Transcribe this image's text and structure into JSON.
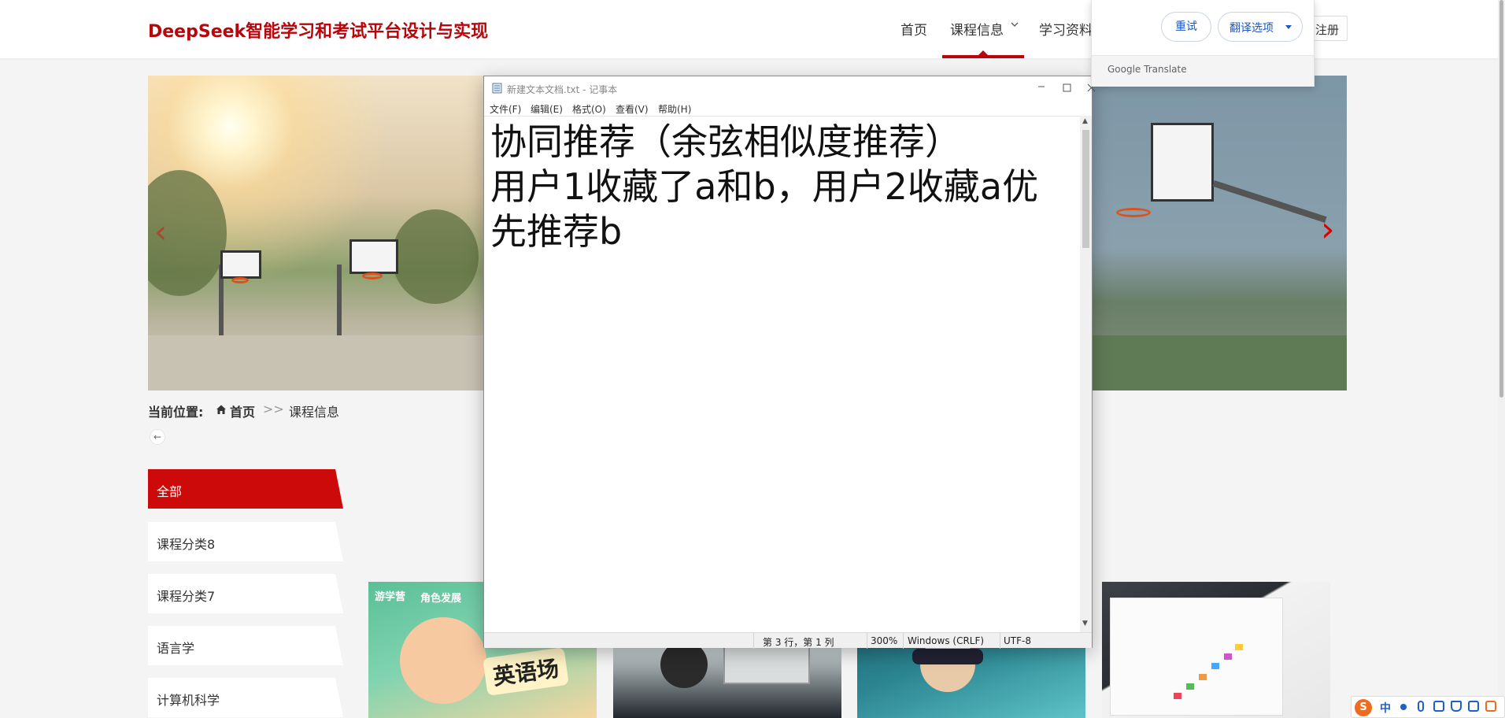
{
  "site": {
    "title": "DeepSeek智能学习和考试平台设计与实现",
    "nav": {
      "home": "首页",
      "course": "课程信息",
      "materials": "学习资料",
      "register": "注册"
    }
  },
  "breadcrumb": {
    "label": "当前位置:",
    "home": "首页",
    "separator": ">>",
    "current": "课程信息"
  },
  "categories": [
    "全部",
    "课程分类8",
    "课程分类7",
    "语言学",
    "计算机科学"
  ],
  "cards": {
    "card1_badge": "游学营",
    "card1_badge2": "角色发展",
    "card1_tag": "英语场"
  },
  "notepad": {
    "title": "新建文本文档.txt - 记事本",
    "menu": [
      "文件(F)",
      "编辑(E)",
      "格式(O)",
      "查看(V)",
      "帮助(H)"
    ],
    "content": "协同推荐（余弦相似度推荐）\n用户1收藏了a和b，用户2收藏a优先推荐b",
    "status": {
      "position": "第 3 行，第 1 列",
      "zoom": "300%",
      "line_ending": "Windows (CRLF)",
      "encoding": "UTF-8"
    }
  },
  "translate_popup": {
    "retry": "重试",
    "options": "翻译选项",
    "brand": "Google Translate"
  },
  "ime": {
    "lang": "中"
  },
  "colors": {
    "brand_red": "#b8060c",
    "active_category": "#cc0a0a",
    "translate_blue": "#1a56c4"
  },
  "icons": [
    "home-icon",
    "back-arrow-icon",
    "chevron-down-icon",
    "notepad-app-icon",
    "minimize-icon",
    "maximize-icon",
    "close-icon",
    "chevron-left-icon",
    "chevron-right-icon",
    "sogou-ime-icon"
  ]
}
